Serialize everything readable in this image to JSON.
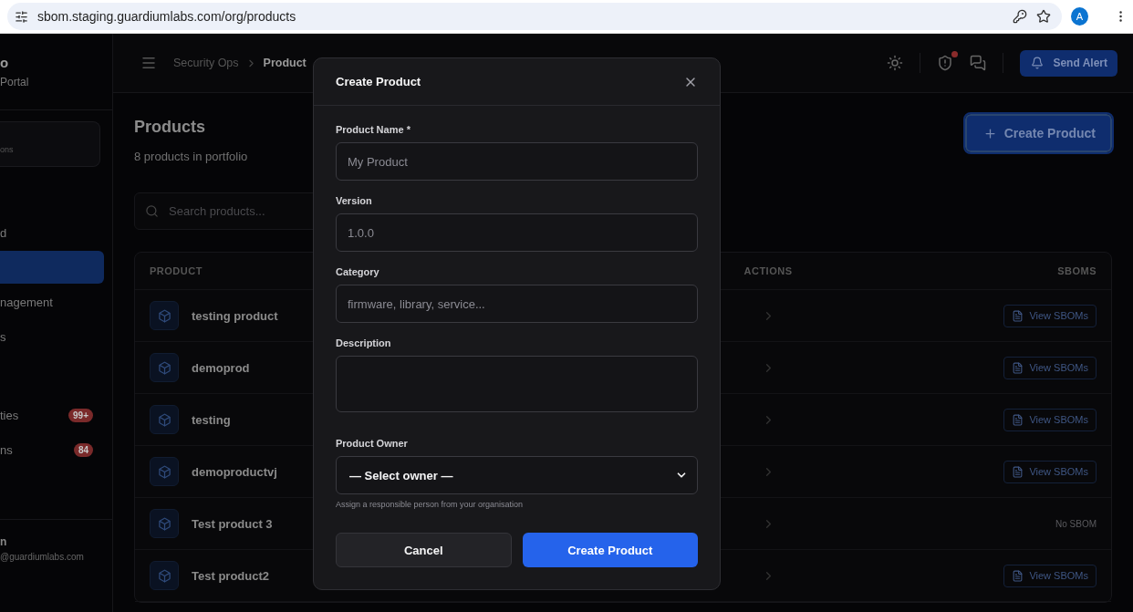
{
  "browser": {
    "url": "sbom.staging.guardiumlabs.com/org/products",
    "avatar": "A"
  },
  "sidebar": {
    "brand_title": "o",
    "brand_subtitle": "Portal",
    "card_text": "ons",
    "groups": [
      {
        "items": [
          {
            "label": "d",
            "selected": false
          },
          {
            "selected": true
          },
          {
            "label": "nagement",
            "selected": false
          },
          {
            "label": "s",
            "selected": false
          }
        ]
      },
      {
        "items": [
          {
            "label": "ties",
            "selected": false,
            "badge": "99+"
          },
          {
            "label": "ns",
            "selected": false,
            "badge": "84"
          }
        ]
      }
    ],
    "footer": {
      "name": "n",
      "email": "@guardiumlabs.com"
    }
  },
  "header": {
    "breadcrumb": [
      "Security Ops",
      "Product"
    ],
    "has_alert": true,
    "send_alert": "Send Alert"
  },
  "page": {
    "title": "Products",
    "subtitle": "8 products in portfolio",
    "create_button": "Create Product",
    "search": {
      "placeholder": "Search products..."
    },
    "table": {
      "columns": [
        {
          "label": "PRODUCT"
        },
        {
          "label": "ACTIONS"
        },
        {
          "label": "SBOMS"
        }
      ],
      "rows": [
        {
          "name": "testing product",
          "sbom": {
            "kind": "button",
            "label": "View SBOMs"
          }
        },
        {
          "name": "demoprod",
          "sbom": {
            "kind": "button",
            "label": "View SBOMs"
          }
        },
        {
          "name": "testing",
          "sbom": {
            "kind": "button",
            "label": "View SBOMs"
          }
        },
        {
          "name": "demoproductvj",
          "sbom": {
            "kind": "button",
            "label": "View SBOMs"
          }
        },
        {
          "name": "Test product 3",
          "sbom": {
            "kind": "none",
            "label": "No SBOM"
          }
        },
        {
          "name": "Test product2",
          "sbom": {
            "kind": "button",
            "label": "View SBOMs"
          }
        }
      ]
    }
  },
  "modal": {
    "title": "Create Product",
    "fields": [
      {
        "kind": "input",
        "label": "Product Name *",
        "placeholder": "My Product"
      },
      {
        "kind": "input",
        "label": "Version",
        "placeholder": "1.0.0"
      },
      {
        "kind": "input",
        "label": "Category",
        "placeholder": "firmware, library, service..."
      },
      {
        "kind": "textarea",
        "label": "Description"
      },
      {
        "kind": "select",
        "label": "Product Owner",
        "value": "— Select owner —",
        "hint": "Assign a responsible person from your organisation"
      }
    ],
    "cancel": "Cancel",
    "submit": "Create Product"
  }
}
